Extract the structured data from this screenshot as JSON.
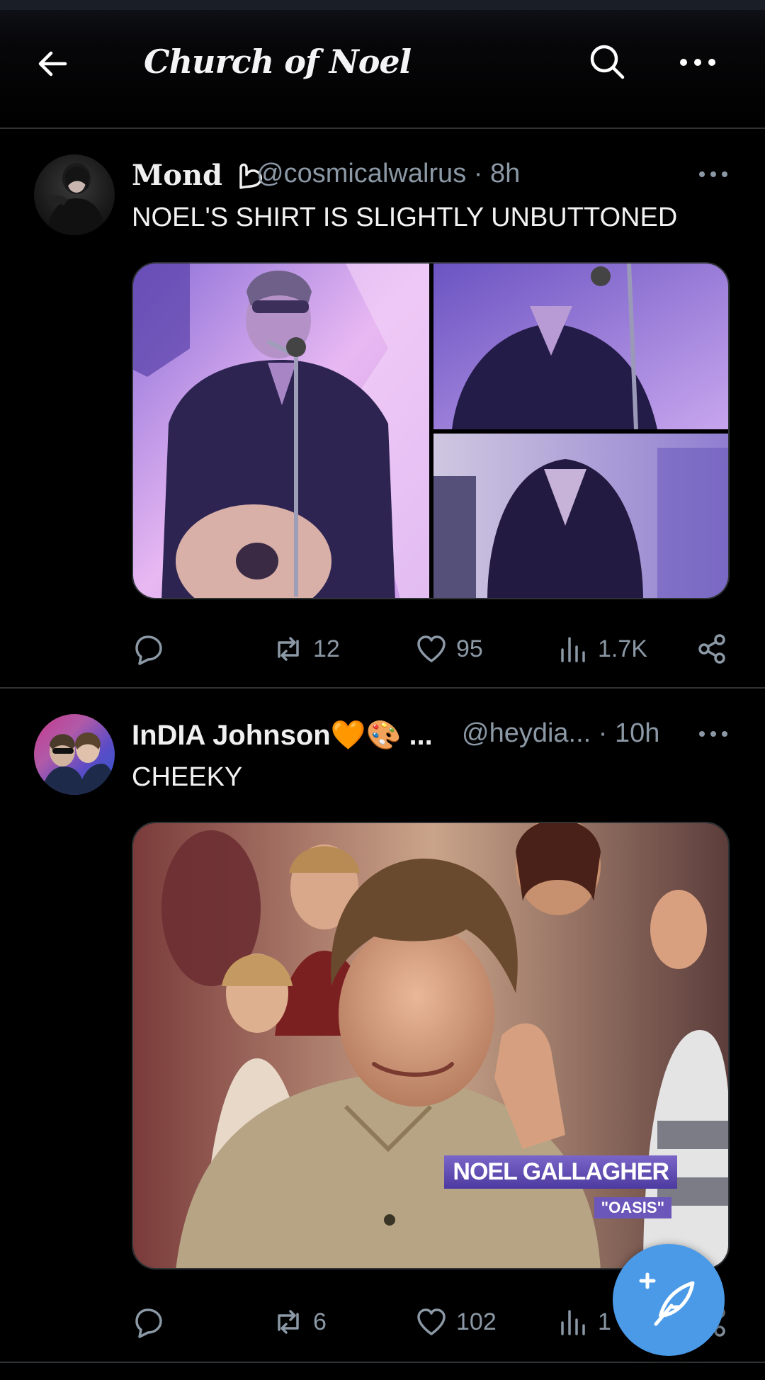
{
  "header": {
    "title": "Church of Noel"
  },
  "tweets": [
    {
      "name": "Mond",
      "handle": "@cosmicalwalrus",
      "time": "· 8h",
      "text": "NOEL'S SHIRT IS SLIGHTLY UNBUTTONED",
      "stats": {
        "reposts": "12",
        "likes": "95",
        "views": "1.7K"
      }
    },
    {
      "name": "InDIA Johnson🧡🎨 ...",
      "handle": "@heydia...",
      "time": "· 10h",
      "text": "CHEEKY",
      "media_caption": "NOEL GALLAGHER",
      "media_subcaption": "\"OASIS\"",
      "stats": {
        "reposts": "6",
        "likes": "102",
        "views": "1"
      }
    }
  ],
  "icons": {
    "back": "back-arrow-icon",
    "search": "search-icon",
    "more": "more-icon",
    "reply": "reply-icon",
    "repost": "repost-icon",
    "like": "heart-icon",
    "views": "views-icon",
    "share": "share-icon",
    "compose": "compose-icon"
  },
  "colors": {
    "background": "#000000",
    "accent": "#4a9ae8",
    "secondary_text": "#8b98a5",
    "divider": "#2f3336"
  }
}
